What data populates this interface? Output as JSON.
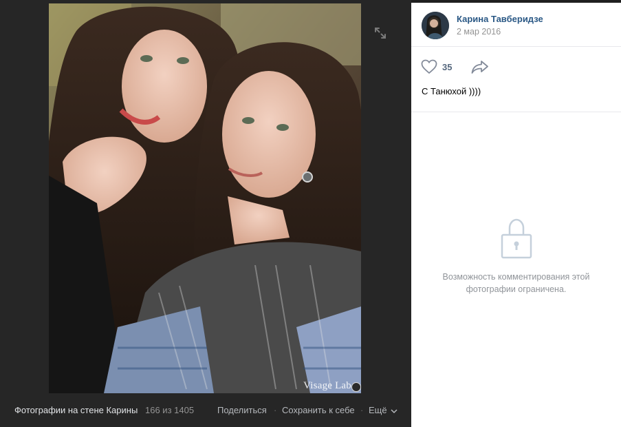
{
  "photo": {
    "watermark": "Visage Lab"
  },
  "icons": {
    "expand": "expand-icon",
    "like": "heart-icon",
    "share": "share-arrow-icon",
    "more": "chevron-down-icon",
    "lock": "lock-icon"
  },
  "bottom_bar": {
    "album_title": "Фотографии на стене Карины",
    "counter": "166 из 1405",
    "share_label": "Поделиться",
    "separator": "·",
    "save_label": "Сохранить к себе",
    "more_label": "Ещё"
  },
  "sidebar": {
    "author_name": "Карина Тавберидзе",
    "date": "2 мар 2016",
    "likes_count": "35",
    "caption": "С Танюхой ))))",
    "comments_closed_text": "Возможность комментирования этой фотографии ограничена."
  },
  "colors": {
    "viewer_bg": "#262626",
    "link_blue": "#2a5885",
    "muted": "#939393"
  }
}
